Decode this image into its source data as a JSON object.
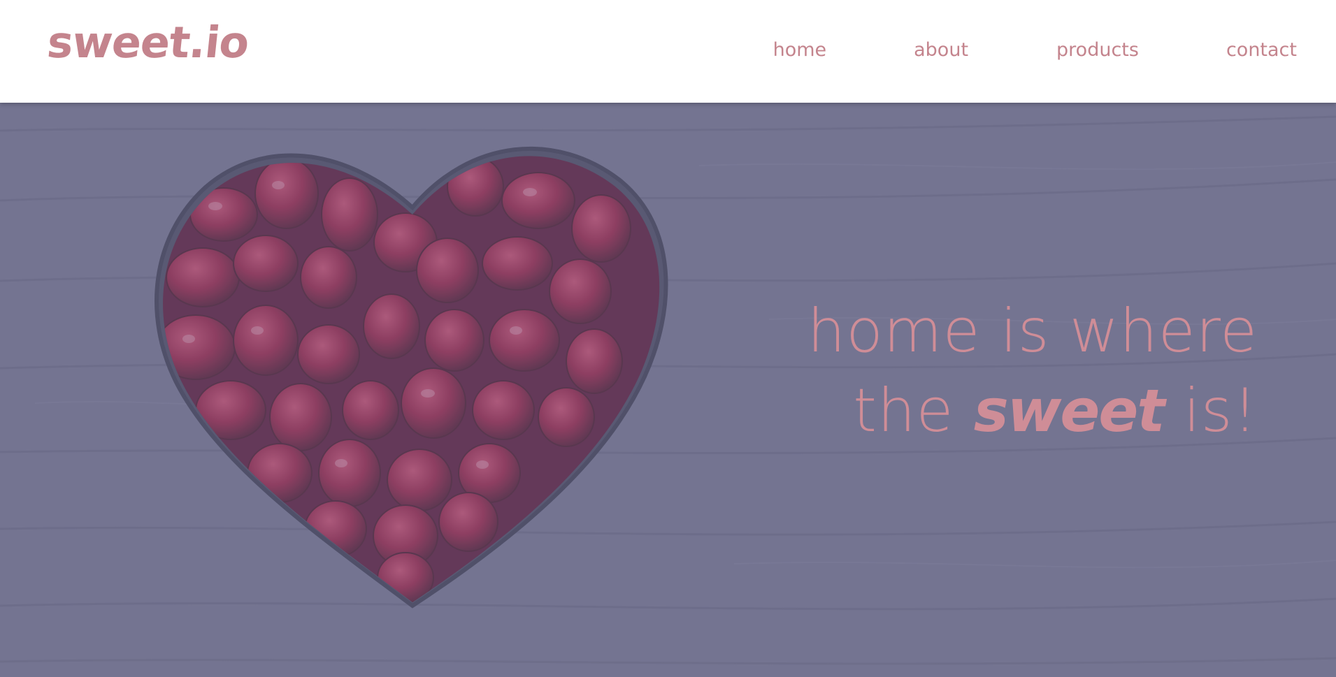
{
  "brand": {
    "logo_text": "sweet.io",
    "color": "#c4848d"
  },
  "nav": {
    "items": [
      {
        "label": "home"
      },
      {
        "label": "about"
      },
      {
        "label": "products"
      },
      {
        "label": "contact"
      }
    ],
    "color": "#c4848d"
  },
  "hero": {
    "line1": "home is where",
    "line2_prefix": "the ",
    "line2_accent": "sweet",
    "line2_suffix": " is!",
    "text_color": "#cf8d97",
    "overlay_color": "#6d6d8c",
    "image_subject": "heart-shaped bowl of pomegranate seeds on wood"
  }
}
